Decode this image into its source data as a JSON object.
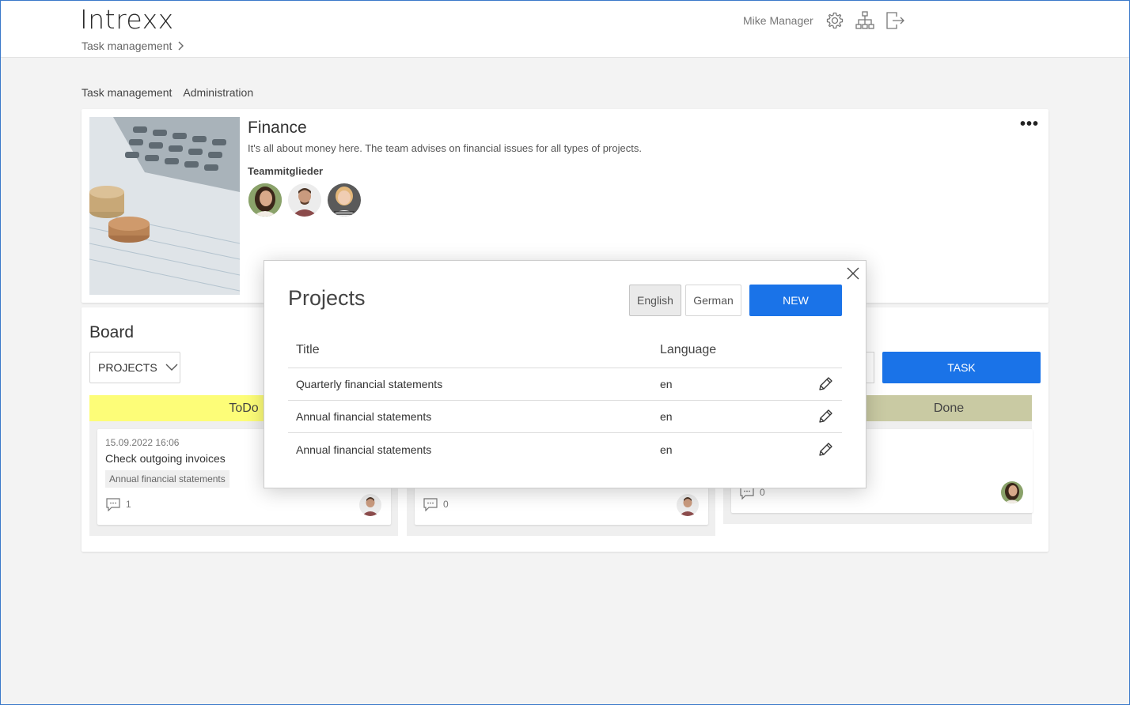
{
  "header": {
    "logo": "Intrexx",
    "breadcrumb": "Task management",
    "user_name": "Mike Manager",
    "icons": [
      "gear-icon",
      "sitemap-icon",
      "logout-icon"
    ]
  },
  "subnav": {
    "items": [
      "Task management",
      "Administration"
    ]
  },
  "team": {
    "title": "Finance",
    "description": "It's all about money here. The team advises on financial issues for all types of projects.",
    "members_label": "Teammitglieder",
    "more_icon": "more-horizontal-icon"
  },
  "board": {
    "title": "Board",
    "select_value": "PROJECTS",
    "task_button": "TASK",
    "columns": [
      {
        "label": "ToDo",
        "color": "#fdfd78"
      },
      {
        "label": "",
        "color": "#efefef"
      },
      {
        "label": "Done",
        "color": "#c9caa3"
      }
    ],
    "cards": [
      {
        "date": "15.09.2022 16:06",
        "title": "Check outgoing invoices",
        "tag": "Annual financial statements",
        "comments": "1"
      },
      {
        "comments": "0"
      },
      {
        "comments": "0"
      }
    ]
  },
  "dialog": {
    "title": "Projects",
    "lang_english": "English",
    "lang_german": "German",
    "new_button": "NEW",
    "col_title": "Title",
    "col_language": "Language",
    "rows": [
      {
        "title": "Quarterly financial statements",
        "language": "en"
      },
      {
        "title": "Annual financial statements",
        "language": "en"
      },
      {
        "title": "Annual financial statements",
        "language": "en"
      }
    ]
  },
  "colors": {
    "accent": "#1a73e8",
    "todo": "#fdfd78",
    "done": "#c9caa3"
  }
}
